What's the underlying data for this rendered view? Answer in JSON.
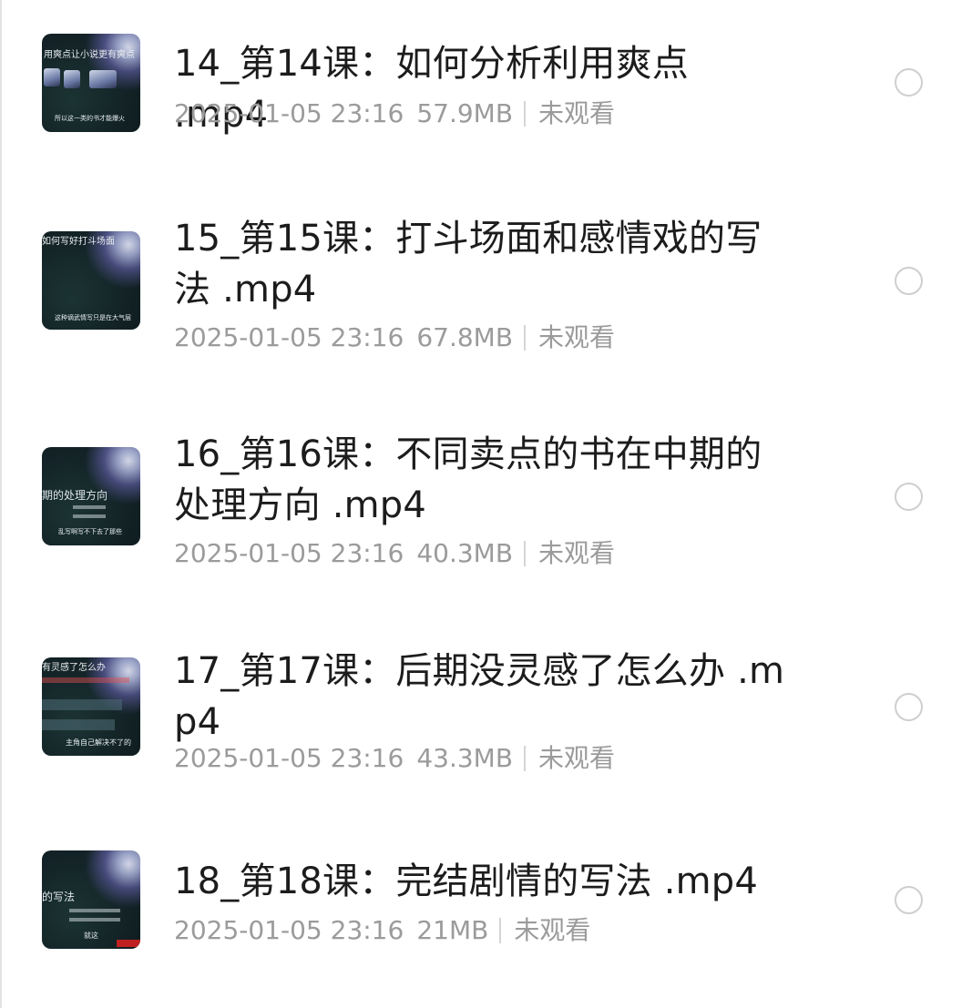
{
  "files": [
    {
      "title": "14_第14课：如何分析利用爽点 .mp4",
      "date": "2025-01-05 23:16",
      "size": "57.9MB",
      "status": "未观看",
      "thumb_caption": "所以这一类的书才能爆火",
      "thumb_heading": "用爽点让小说更有爽点"
    },
    {
      "title": "15_第15课：打斗场面和感情戏的写法 .mp4",
      "date": "2025-01-05 23:16",
      "size": "67.8MB",
      "status": "未观看",
      "thumb_caption": "这种谪武情写只是在大气层",
      "thumb_heading": "如何写好打斗场面"
    },
    {
      "title": "16_第16课：不同卖点的书在中期的处理方向 .mp4",
      "date": "2025-01-05 23:16",
      "size": "40.3MB",
      "status": "未观看",
      "thumb_caption": "乱写啊写不下去了那些",
      "thumb_heading": "期的处理方向"
    },
    {
      "title": "17_第17课：后期没灵感了怎么办 .mp4",
      "date": "2025-01-05 23:16",
      "size": "43.3MB",
      "status": "未观看",
      "thumb_caption": "主角自己解决不了的",
      "thumb_heading": "有灵感了怎么办"
    },
    {
      "title": "18_第18课：完结剧情的写法 .mp4",
      "date": "2025-01-05 23:16",
      "size": "21MB",
      "status": "未观看",
      "thumb_caption": "就这",
      "thumb_heading": "的写法"
    }
  ],
  "colors": {
    "title": "#1c1c1c",
    "meta": "#9b9b9b",
    "separator": "#d5d5d5",
    "radio_border": "#cfcfcf"
  },
  "icons": {
    "select": "radio-unchecked-icon"
  }
}
